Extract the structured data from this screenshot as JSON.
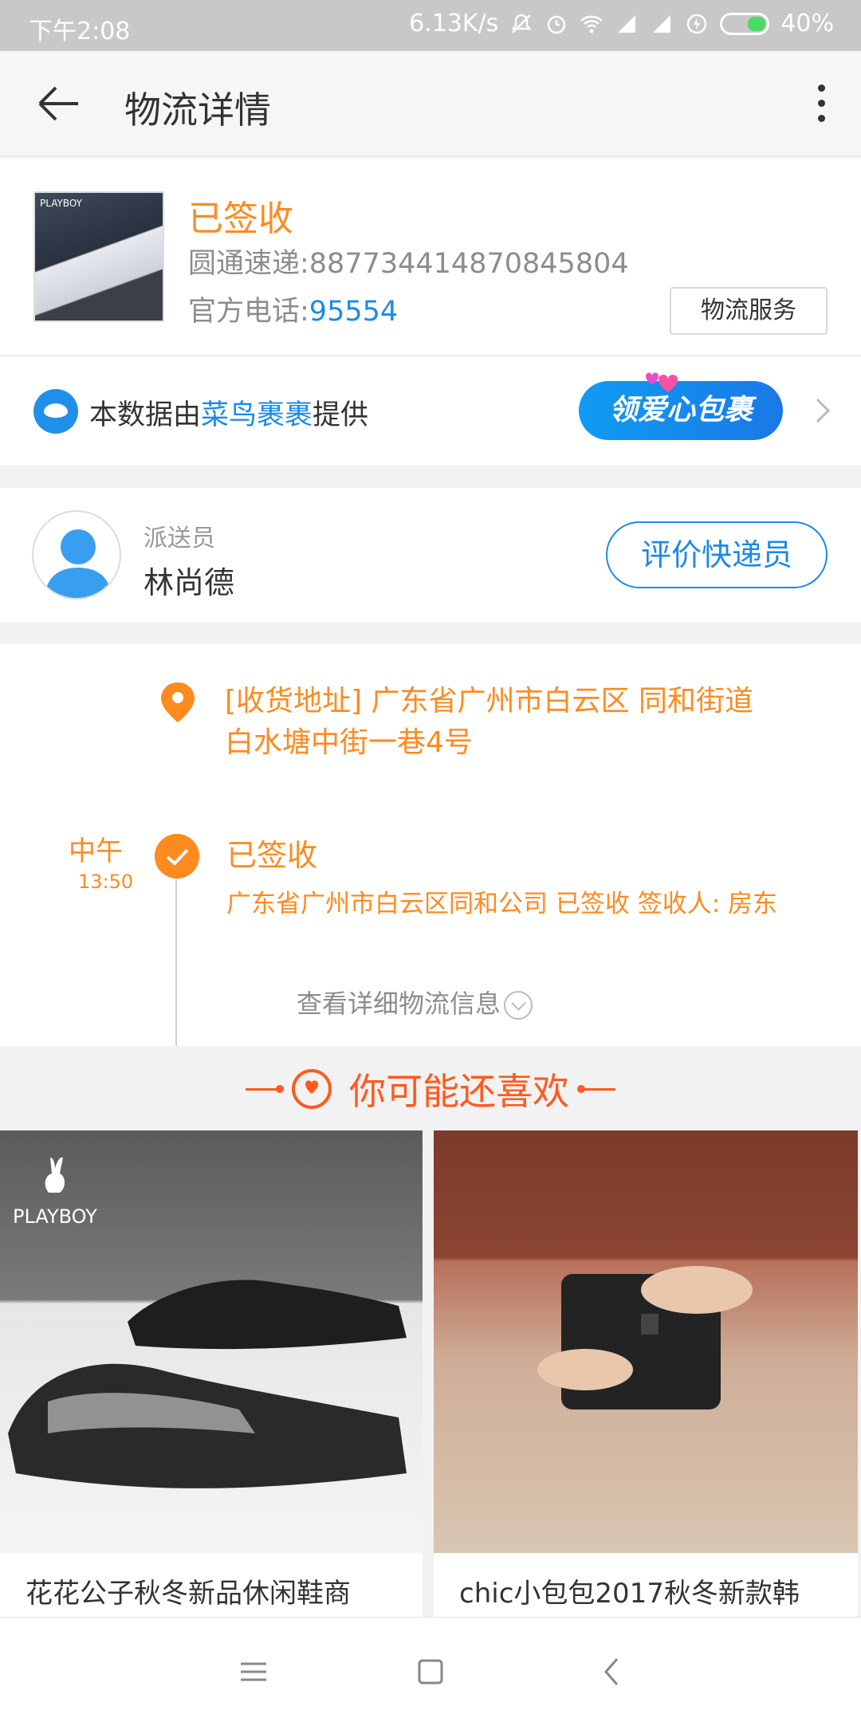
{
  "status_bar": {
    "time": "下午2:08",
    "network_speed": "6.13K/s",
    "battery": "40%"
  },
  "header": {
    "title": "物流详情"
  },
  "package": {
    "status": "已签收",
    "tracking": "圆通速递:887734414870845804",
    "phone_label": "官方电话:",
    "phone_number": "95554",
    "logistics_button": "物流服务",
    "thumb_logo": "PLAYBOY"
  },
  "cainiao": {
    "prefix": "本数据由",
    "link": "菜鸟裹裹",
    "suffix": "提供",
    "promo_button": "领爱心包裹"
  },
  "courier": {
    "role": "派送员",
    "name": "林尚德",
    "rate_button": "评价快递员"
  },
  "timeline": {
    "address_line1": "[收货地址] 广东省广州市白云区 同和街道",
    "address_line2": "白水塘中街一巷4号",
    "period": "中午",
    "clock": "13:50",
    "event_status": "已签收",
    "event_desc": "广东省广州市白云区同和公司 已签收 签收人: 房东",
    "view_more": "查看详细物流信息"
  },
  "recommend": {
    "title": "你可能还喜欢",
    "products": [
      {
        "name": "花花公子秋冬新品休闲鞋商",
        "logo": "PLAYBOY"
      },
      {
        "name": "chic小包包2017秋冬新款韩"
      }
    ]
  },
  "colors": {
    "accent_orange": "#ff8a1f",
    "link_blue": "#1d8ae6",
    "recommend_red": "#ff5a1f"
  }
}
